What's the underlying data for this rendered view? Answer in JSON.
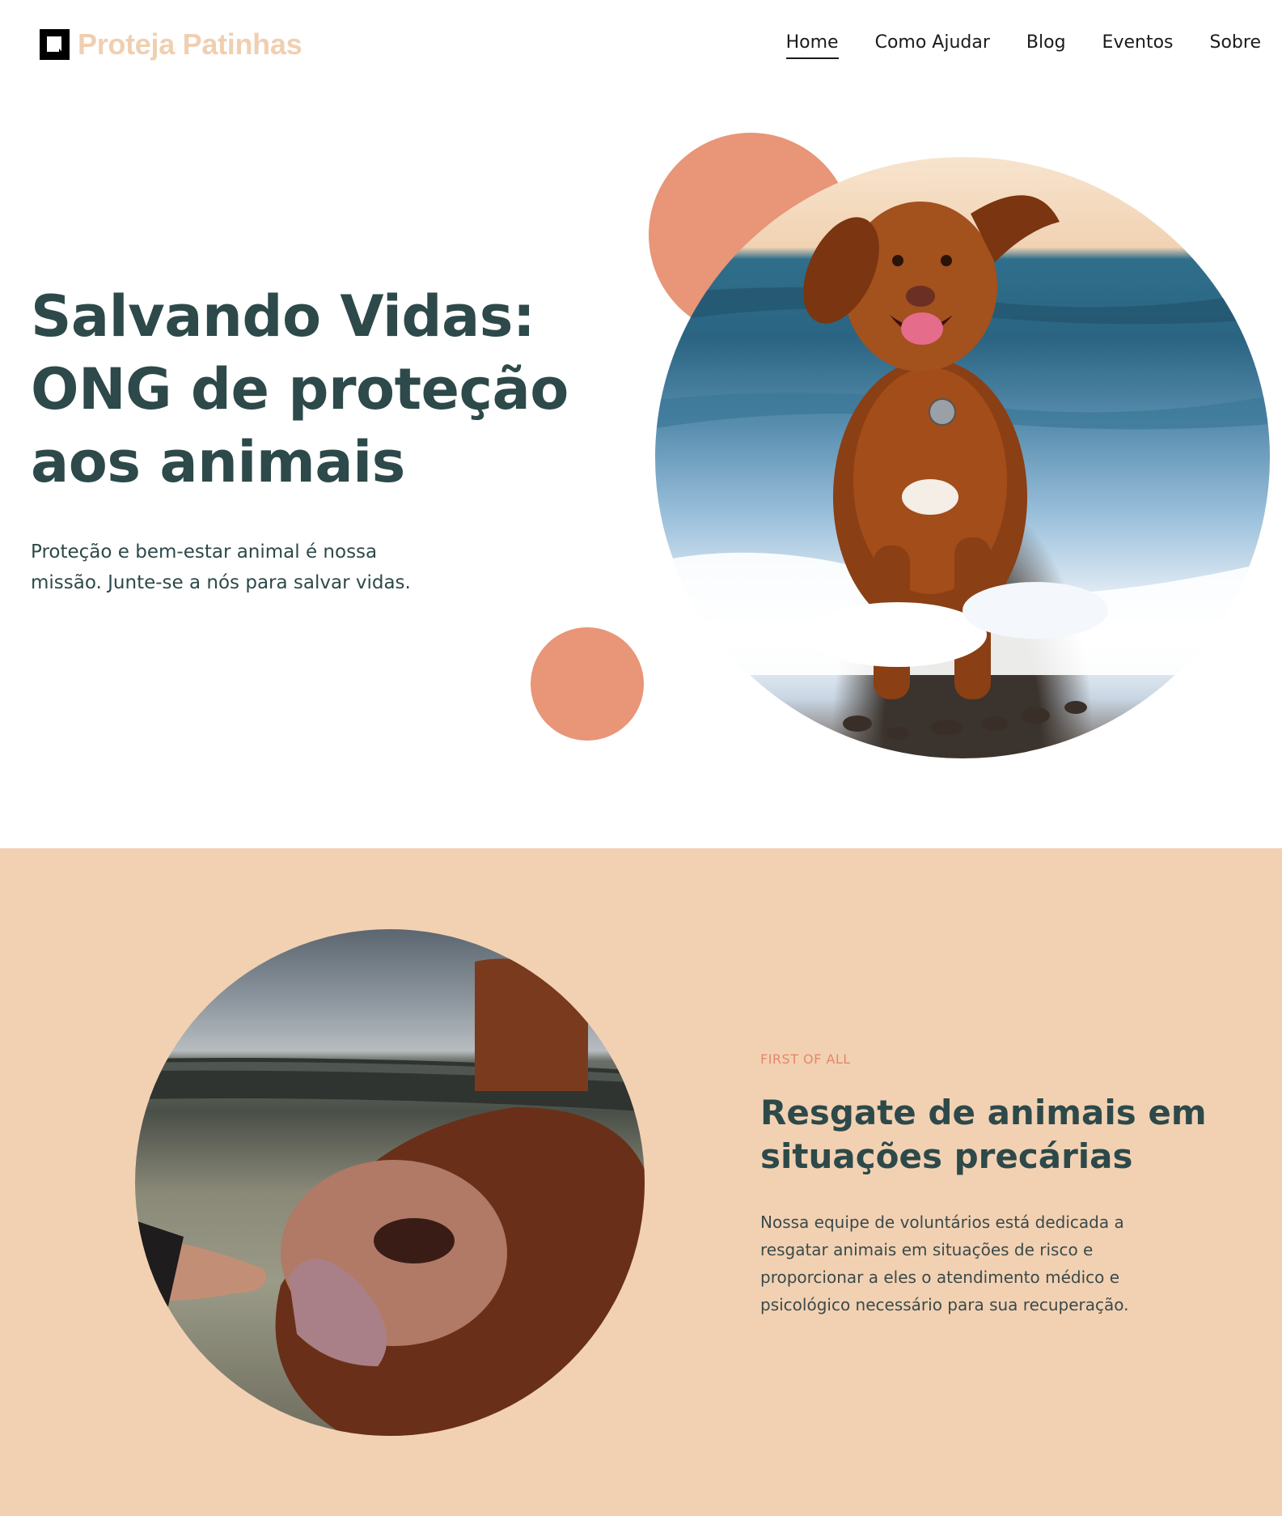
{
  "header": {
    "logo_text": "Proteja Patinhas",
    "nav": [
      {
        "label": "Home",
        "active": true
      },
      {
        "label": "Como Ajudar"
      },
      {
        "label": "Blog"
      },
      {
        "label": "Eventos"
      },
      {
        "label": "Sobre"
      }
    ]
  },
  "hero": {
    "title_lines": [
      "Salvando Vidas:",
      "ONG de proteção",
      "aos animais"
    ],
    "subtitle": "Proteção e bem-estar animal é nossa missão. Junte-se a nós para salvar vidas."
  },
  "rescue": {
    "eyebrow": "FIRST OF ALL",
    "title": "Resgate de animais em situações precárias",
    "body": "Nossa equipe de voluntários está dedicada a resgatar animais em situações de risco e proporcionar a eles o atendimento médico e psicológico necessário para sua recuperação."
  },
  "colors": {
    "brand_peach": "#f0cfb1",
    "accent_coral": "#e89578",
    "heading_teal": "#2d4949",
    "section_bg": "#f2d1b3"
  }
}
